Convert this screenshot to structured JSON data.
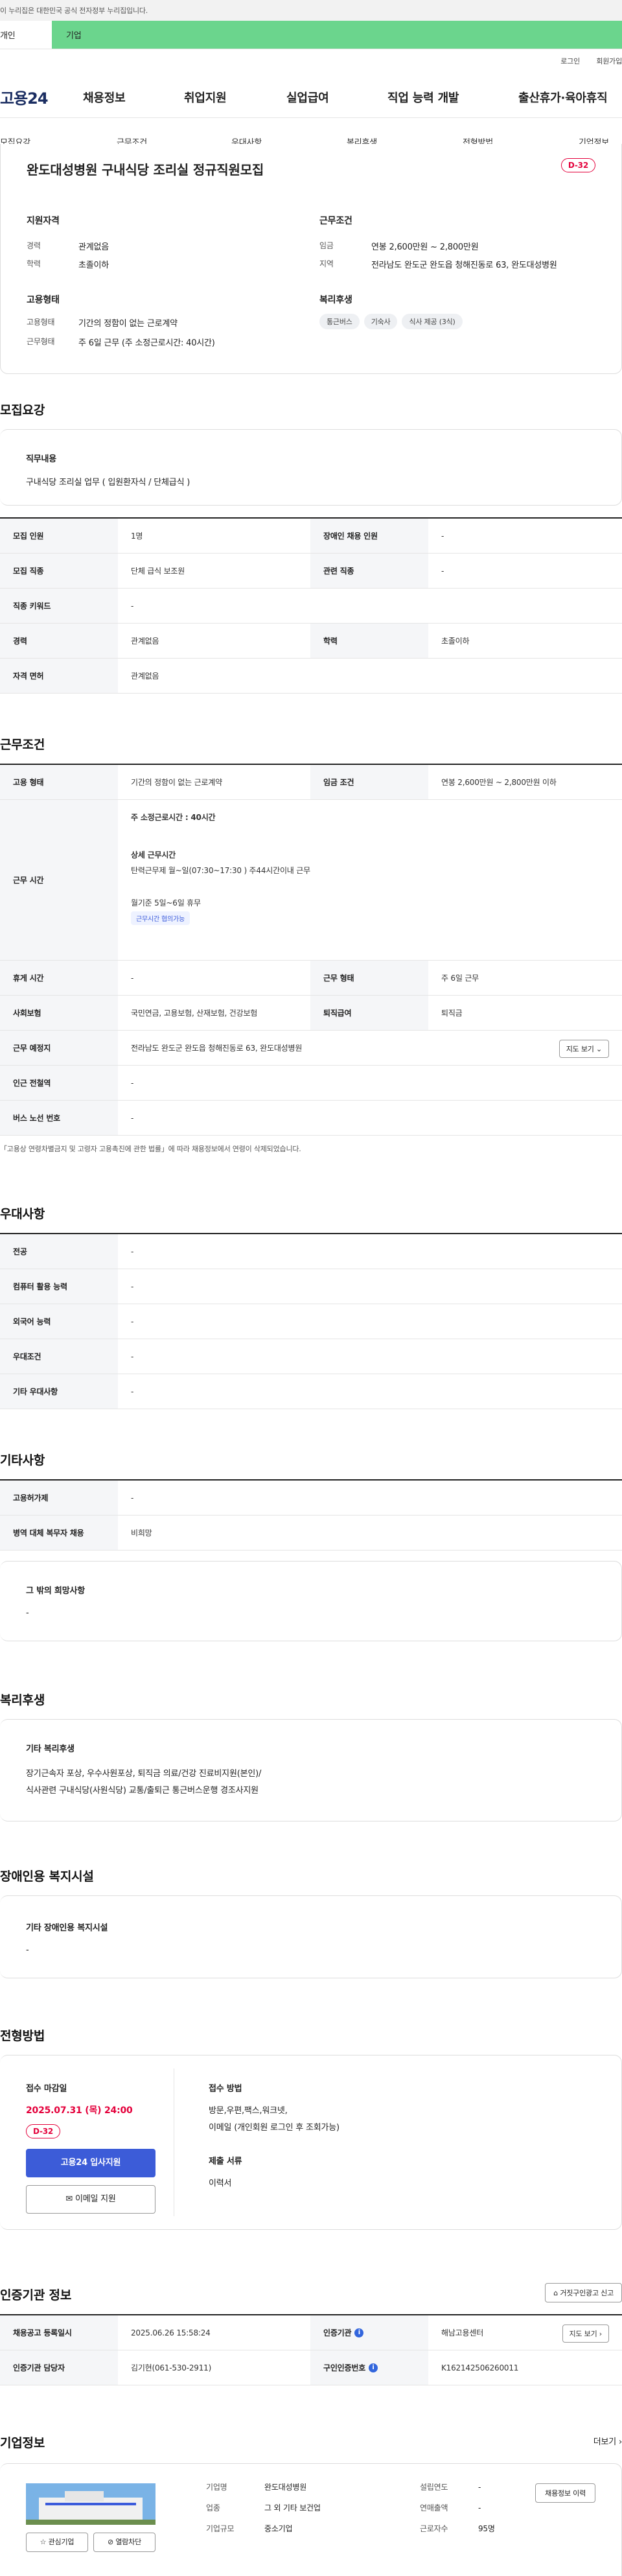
{
  "gov_banner": "이 누리집은 대한민국 공식 전자정부 누리집입니다.",
  "top_tabs": {
    "individual": "개인",
    "company": "기업"
  },
  "utils": {
    "login": "로그인",
    "signup": "회원가입"
  },
  "logo": "고용24",
  "gnb": [
    "채용정보",
    "취업지원",
    "실업급여",
    "직업 능력 개발",
    "출산휴가·육아휴직"
  ],
  "snb": [
    "모집요강",
    "근무조건",
    "우대사항",
    "복리후생",
    "전형방법",
    "기업정보"
  ],
  "header": {
    "title": "완도대성병원 구내식당 조리실 정규직원모집",
    "dday": "D-32",
    "support_title": "지원자격",
    "career_label": "경력",
    "career": "관계없음",
    "edu_label": "학력",
    "edu": "초졸이하",
    "cond_title": "근무조건",
    "wage_label": "임금",
    "wage": "연봉 2,600만원 ~ 2,800만원",
    "region_label": "지역",
    "region": "전라남도 완도군 완도읍 청해진동로 63, 완도대성병원",
    "emp_title": "고용형태",
    "emptype_label": "고용형태",
    "emptype": "기간의 정함이 없는 근로계약",
    "worktype_label": "근무형태",
    "worktype": "주 6일 근무 (주 소정근로시간: 40시간)",
    "welfare_title": "복리후생",
    "welfare_chips": [
      "통근버스",
      "기숙사",
      "식사 제공 (3식)"
    ]
  },
  "recruit": {
    "title": "모집요강",
    "duty_label": "직무내용",
    "duty": "구내식당 조리실 업무 ( 입원환자식 / 단체급식 )",
    "rows": [
      [
        "모집 인원",
        "1명",
        "장애인 채용 인원",
        "-"
      ],
      [
        "모집 직종",
        "단체 급식 보조원",
        "관련 직종",
        "-"
      ],
      [
        "직종 키워드",
        "-"
      ],
      [
        "경력",
        "관계없음",
        "학력",
        "초졸이하"
      ],
      [
        "자격 면허",
        "관계없음"
      ]
    ]
  },
  "work": {
    "title": "근무조건",
    "emp_label": "고용 형태",
    "emp": "기간의 정함이 없는 근로계약",
    "wage_label": "임금 조건",
    "wage": "연봉 2,600만원 ~ 2,800만원 이하",
    "hours_label": "근무 시간",
    "weekly": "주 소정근로시간 : 40시간",
    "detail_title": "상세 근무시간",
    "detail": "탄력근무제 월~일(07:30~17:30 ) 주44시간이내 근무",
    "days": "월기준 5일~6일 휴무",
    "flex_tag": "근무시간 협의가능",
    "rows": [
      [
        "휴게 시간",
        "-",
        "근무 형태",
        "주 6일 근무"
      ],
      [
        "사회보험",
        "국민연금, 고용보험, 산재보험, 건강보험",
        "퇴직급여",
        "퇴직금"
      ],
      [
        "근무 예정지",
        "전라남도 완도군 완도읍 청해진동로 63, 완도대성병원"
      ],
      [
        "인근 전철역",
        "-"
      ],
      [
        "버스 노선 번호",
        "-"
      ]
    ],
    "map_btn": "지도 보기",
    "note": "「고용상 연령차별금지 및 고령자 고용촉진에 관한 법률」에 따라 채용정보에서 연령이 삭제되었습니다."
  },
  "pref": {
    "title": "우대사항",
    "rows": [
      [
        "전공",
        "-"
      ],
      [
        "컴퓨터 활용 능력",
        "-"
      ],
      [
        "외국어 능력",
        "-"
      ],
      [
        "우대조건",
        "-"
      ],
      [
        "기타 우대사항",
        "-"
      ]
    ]
  },
  "etc": {
    "title": "기타사항",
    "rows": [
      [
        "고용허가제",
        "-"
      ],
      [
        "병역 대체 복무자 채용",
        "비희망"
      ]
    ],
    "wish_label": "그 밖의 희망사항",
    "wish": "-"
  },
  "welfare": {
    "title": "복리후생",
    "label": "기타 복리후생",
    "line1": "장기근속자 포상, 우수사원포상, 퇴직금 의료/건강 진료비지원(본인)/",
    "line2": "식사관련 구내식당(사원식당) 교통/출퇴근 통근버스운행 경조사지원"
  },
  "disabled": {
    "title": "장애인용 복지시설",
    "label": "기타 장애인용 복지시설",
    "value": "-"
  },
  "process": {
    "title": "전형방법",
    "deadline_label": "접수 마감일",
    "deadline": "2025.07.31 (목) 24:00",
    "dday": "D-32",
    "apply_btn": "고용24 입사지원",
    "email_btn": "이메일 지원",
    "method_label": "접수 방법",
    "method": "방문,우편,팩스,워크넷,",
    "method2": "이메일 (개인회원 로그인 후 조회가능)",
    "docs_label": "제출 서류",
    "docs": "이력서"
  },
  "agency": {
    "title": "인증기관 정보",
    "report_btn": "거짓구인광고 신고",
    "reg_label": "채용공고 등록일시",
    "reg": "2025.06.26 15:58:24",
    "org_label": "인증기관",
    "org": "해남고용센터",
    "map_btn": "지도 보기",
    "mgr_label": "인증기관 담당자",
    "mgr": "김기현(061-530-2911)",
    "cert_label": "구인인증번호",
    "cert": "K162142506260011"
  },
  "company": {
    "title": "기업정보",
    "more": "더보기",
    "name_label": "기업명",
    "name": "완도대성병원",
    "year_label": "설립연도",
    "year": "-",
    "ind_label": "업종",
    "ind": "그 외 기타 보건업",
    "sales_label": "연매출액",
    "sales": "-",
    "size_label": "기업규모",
    "size": "중소기업",
    "emp_label": "근로자수",
    "emp": "95명",
    "hist_btn": "채용정보 이력",
    "interest_btn": "관심기업",
    "block_btn": "열람차단"
  }
}
